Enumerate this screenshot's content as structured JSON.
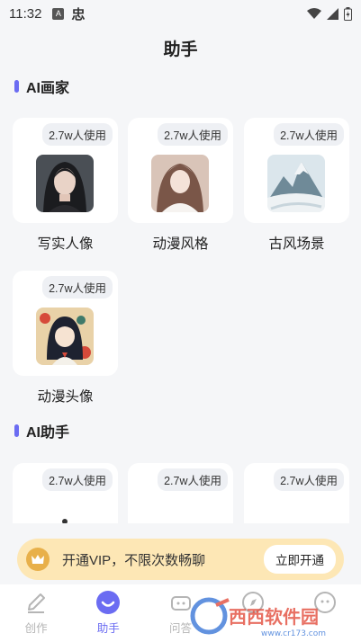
{
  "status_bar": {
    "time": "11:32",
    "indicators": [
      "A",
      "忠"
    ]
  },
  "header": {
    "title": "助手"
  },
  "sections": [
    {
      "title": "AI画家",
      "cards": [
        {
          "usage": "2.7w人使用",
          "label": "写实人像",
          "thumb": "realistic-portrait-image"
        },
        {
          "usage": "2.7w人使用",
          "label": "动漫风格",
          "thumb": "anime-style-image"
        },
        {
          "usage": "2.7w人使用",
          "label": "古风场景",
          "thumb": "ancient-landscape-image"
        },
        {
          "usage": "2.7w人使用",
          "label": "动漫头像",
          "thumb": "anime-avatar-image"
        }
      ]
    },
    {
      "title": "AI助手",
      "cards": [
        {
          "usage": "2.7w人使用",
          "thumb": "robot-icon"
        },
        {
          "usage": "2.7w人使用",
          "thumb": "book-icon"
        },
        {
          "usage": "2.7w人使用",
          "thumb": "graduation-cap-icon"
        }
      ]
    }
  ],
  "vip_banner": {
    "text": "开通VIP，不限次数畅聊",
    "button": "立即开通"
  },
  "tab_bar": {
    "tabs": [
      {
        "label": "创作",
        "icon": "pencil-icon",
        "active": false
      },
      {
        "label": "助手",
        "icon": "smile-icon",
        "active": true
      },
      {
        "label": "问答",
        "icon": "chat-icon",
        "active": false
      },
      {
        "label": "",
        "icon": "compass-icon",
        "active": false
      },
      {
        "label": "",
        "icon": "profile-icon",
        "active": false
      }
    ]
  },
  "watermark": {
    "text": "西西软件园",
    "url_text": "www.cr173.com"
  },
  "colors": {
    "accent": "#6b6cf2",
    "vip_bg": "#fde7b5",
    "badge_bg": "#eef0f4"
  }
}
